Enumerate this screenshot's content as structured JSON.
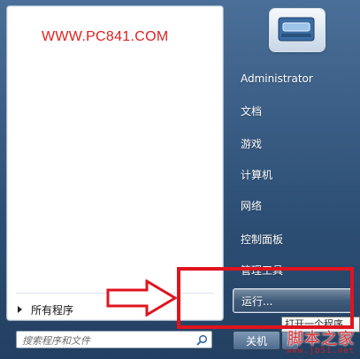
{
  "watermark": "WWW.PC841.COM",
  "left_pane": {
    "all_programs_label": "所有程序",
    "search_placeholder": "搜索程序和文件"
  },
  "right_pane": {
    "items": [
      {
        "label": "Administrator"
      },
      {
        "label": "文档"
      },
      {
        "label": "游戏"
      },
      {
        "label": "计算机"
      },
      {
        "label": "网络"
      },
      {
        "label": "控制面板"
      },
      {
        "label": "管理工具"
      },
      {
        "label": "运行..."
      }
    ],
    "shutdown_label": "关机",
    "tooltip": "打开一个程序"
  },
  "site_logo": {
    "text": "脚本之家",
    "domain": "www.jb51.net"
  },
  "colors": {
    "highlight_frame": "#e0141e",
    "watermark": "#e02020"
  },
  "icons": {
    "search": "search-icon",
    "user_tile": "user-picture-icon"
  }
}
